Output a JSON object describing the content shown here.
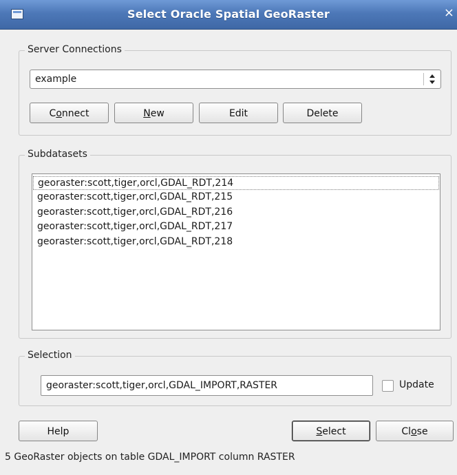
{
  "window": {
    "title": "Select Oracle Spatial GeoRaster",
    "close_glyph": "×"
  },
  "server_connections": {
    "label": "Server Connections",
    "selected_connection": "example",
    "buttons": {
      "connect": {
        "pre": "C",
        "mnemonic": "o",
        "post": "nnect"
      },
      "new": {
        "pre": "",
        "mnemonic": "N",
        "post": "ew"
      },
      "edit": "Edit",
      "delete": "Delete"
    }
  },
  "subdatasets": {
    "label": "Subdatasets",
    "items": [
      "georaster:scott,tiger,orcl,GDAL_RDT,214",
      "georaster:scott,tiger,orcl,GDAL_RDT,215",
      "georaster:scott,tiger,orcl,GDAL_RDT,216",
      "georaster:scott,tiger,orcl,GDAL_RDT,217",
      "georaster:scott,tiger,orcl,GDAL_RDT,218"
    ]
  },
  "selection": {
    "label": "Selection",
    "value": "georaster:scott,tiger,orcl,GDAL_IMPORT,RASTER",
    "update_label": "Update",
    "update_checked": false
  },
  "footer": {
    "help": "Help",
    "select": {
      "pre": "",
      "mnemonic": "S",
      "post": "elect"
    },
    "close": {
      "pre": "Cl",
      "mnemonic": "o",
      "post": "se"
    },
    "status": "5 GeoRaster objects on table GDAL_IMPORT column RASTER"
  }
}
